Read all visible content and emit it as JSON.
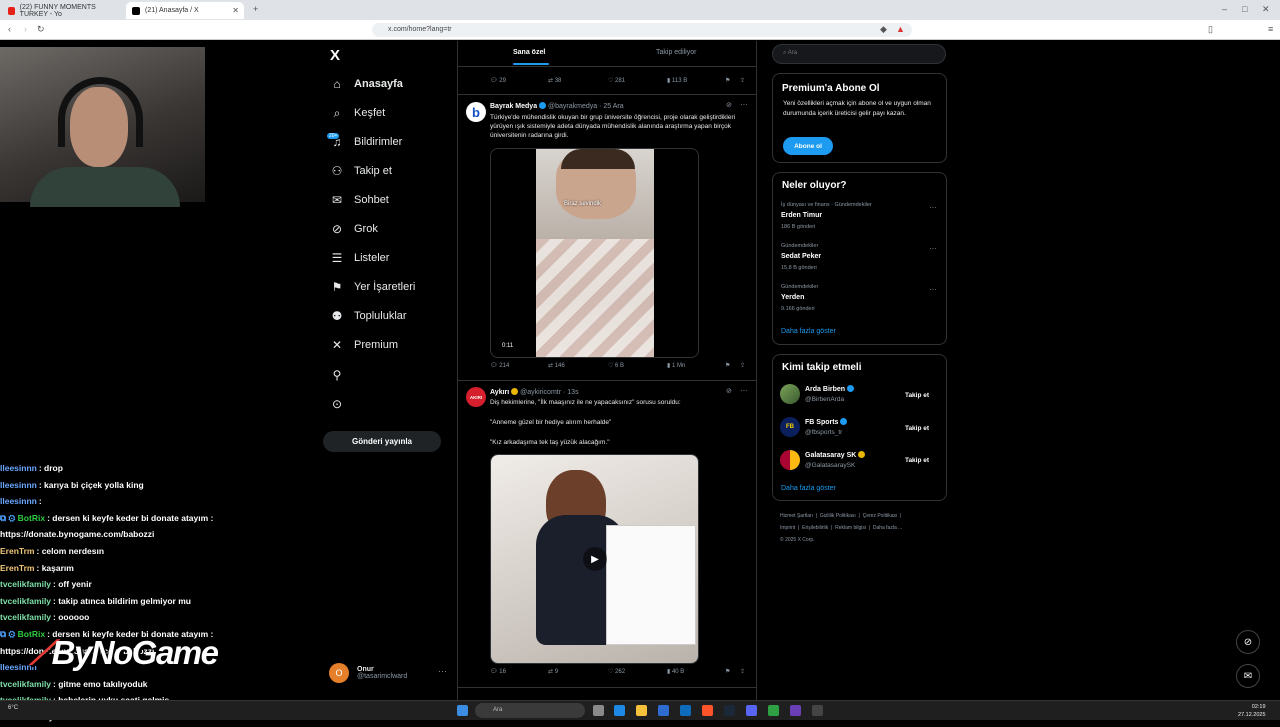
{
  "browser": {
    "tabs": [
      {
        "title": "(22) FUNNY MOMENTS TURKEY - Yo",
        "active": false
      },
      {
        "title": "(21) Anasayfa / X",
        "active": true
      }
    ],
    "url": "x.com/home?lang=tr"
  },
  "nav": {
    "logo": "X",
    "items": [
      {
        "label": "Anasayfa",
        "icon": "home-icon"
      },
      {
        "label": "Keşfet",
        "icon": "search-icon"
      },
      {
        "label": "Bildirimler",
        "icon": "bell-icon"
      },
      {
        "label": "Takip et",
        "icon": "add-user-icon"
      },
      {
        "label": "Sohbet",
        "icon": "mail-icon"
      },
      {
        "label": "Grok",
        "icon": "grok-icon"
      },
      {
        "label": "Listeler",
        "icon": "list-icon"
      },
      {
        "label": "Yer İşaretleri",
        "icon": "bookmark-icon"
      },
      {
        "label": "Topluluklar",
        "icon": "communities-icon"
      },
      {
        "label": "Premium",
        "icon": "x-icon"
      }
    ],
    "badge": "20+",
    "post_button": "Gönderi yayınla",
    "profile": {
      "initial": "O",
      "name": "Onur",
      "handle": "@tasarimclward"
    }
  },
  "timeline": {
    "tabs": [
      "Sana özel",
      "Takip ediliyor"
    ],
    "top_actions": {
      "replies": "29",
      "reposts": "38",
      "likes": "281",
      "views": "113 B"
    },
    "posts": [
      {
        "name": "Bayrak Medya",
        "handle": "@bayrakmedya",
        "time": "· 25 Ara",
        "text": "Türkiye'de mühendislik okuyan bir grup üniversite öğrencisi, proje olarak geliştirdikleri yürüyen ışık sistemiyle adeta dünyada mühendislik alanında araştırma yapan birçok üniversitenin radarına girdi.",
        "video_caption": "Biraz sevindik",
        "duration": "0:11",
        "replies": "214",
        "reposts": "146",
        "likes": "6 B",
        "views": "1 Mn"
      },
      {
        "name": "Aykırı",
        "handle": "@aykiricomtr",
        "time": "· 13s",
        "avatar_text": "AKIRI",
        "text1": "Diş hekimlerine, \"İlk maaşınız ile ne yapacaksınız\" sorusu soruldu:",
        "text2": "\"Anneme güzel bir hediye alırım herhalde\"",
        "text3": "\"Kız arkadaşıma tek taş yüzük alacağım.\"",
        "replies": "16",
        "reposts": "9",
        "likes": "262",
        "views": "40 B"
      }
    ]
  },
  "sidebar": {
    "search_placeholder": "Ara",
    "premium": {
      "title": "Premium'a Abone Ol",
      "text": "Yeni özellikleri açmak için abone ol ve uygun olman durumunda içerik üreticisi gelir payı kazan.",
      "button": "Abone ol"
    },
    "trends": {
      "title": "Neler oluyor?",
      "items": [
        {
          "category": "İş dünyası ve finans · Gündemdekiler",
          "name": "Erden Timur",
          "count": "186 B gönderi"
        },
        {
          "category": "Gündemdekiler",
          "name": "Sedat Peker",
          "count": "15,8 B gönderi"
        },
        {
          "category": "Gündemdekiler",
          "name": "Yerden",
          "count": "9.166 gönderi"
        }
      ],
      "more": "Daha fazla göster"
    },
    "who_to_follow": {
      "title": "Kimi takip etmeli",
      "items": [
        {
          "name": "Arda Birben",
          "handle": "@BirbenArda",
          "button": "Takip et"
        },
        {
          "name": "FB Sports",
          "handle": "@fbsports_tr",
          "button": "Takip et"
        },
        {
          "name": "Galatasaray SK",
          "handle": "@GalatasaraySK",
          "button": "Takip et"
        }
      ],
      "more": "Daha fazla göster"
    },
    "footer": {
      "links": [
        "Hizmet Şartları",
        "Gizlilik Politikası",
        "Çerez Politikası",
        "Imprint",
        "Erişilebilirlik",
        "Reklam bilgisi",
        "Daha fazla ..."
      ],
      "copyright": "© 2025 X Corp."
    }
  },
  "chat": [
    {
      "user": "lleesinnn",
      "msg": ": drop",
      "color": "#6aa7ff",
      "bot": false
    },
    {
      "user": "lleesinnn",
      "msg": ": karıya bi çiçek yolla king",
      "color": "#6aa7ff",
      "bot": false
    },
    {
      "user": "lleesinnn",
      "msg": ":",
      "color": "#6aa7ff",
      "bot": false
    },
    {
      "user": "BotRix",
      "msg": ": dersen ki keyfe keder bi donate atayım :",
      "color": "#2ecc40",
      "bot": true
    },
    {
      "user": "",
      "msg": "https://donate.bynogame.com/babozzi",
      "color": "#fff",
      "bot": false
    },
    {
      "user": "ErenTrm",
      "msg": ": celom nerdesın",
      "color": "#f2c879",
      "bot": false
    },
    {
      "user": "ErenTrm",
      "msg": ": kaşarım",
      "color": "#f2c879",
      "bot": false
    },
    {
      "user": "tvcelikfamily",
      "msg": ": off yenir",
      "color": "#7fe0a8",
      "bot": false
    },
    {
      "user": "tvcelikfamily",
      "msg": ": takip atınca bildirim gelmiyor mu",
      "color": "#7fe0a8",
      "bot": false
    },
    {
      "user": "tvcelikfamily",
      "msg": ": oooooo",
      "color": "#7fe0a8",
      "bot": false
    },
    {
      "user": "BotRix",
      "msg": ": dersen ki keyfe keder bi donate atayım :",
      "color": "#2ecc40",
      "bot": true
    },
    {
      "user": "",
      "msg": "https://donate.bynogame.com/babozzi",
      "color": "#fff",
      "bot": false
    },
    {
      "user": "lleesinnn",
      "msg": "",
      "color": "#6aa7ff",
      "bot": false
    },
    {
      "user": "tvcelikfamily",
      "msg": ": gitme emo takılıyoduk",
      "color": "#7fe0a8",
      "bot": false
    },
    {
      "user": "tvcelikfamily",
      "msg": ": bebelerin uyku saati gelmiş",
      "color": "#7fe0a8",
      "bot": false
    },
    {
      "user": "lleesinnn",
      "msg": ": aynennnnn",
      "color": "#6aa7ff",
      "bot": false
    }
  ],
  "overlay_logo": "ByNoGame",
  "taskbar": {
    "search": "Ara",
    "weather": "6°C",
    "time": "02:19",
    "date": "27.12.2025"
  }
}
